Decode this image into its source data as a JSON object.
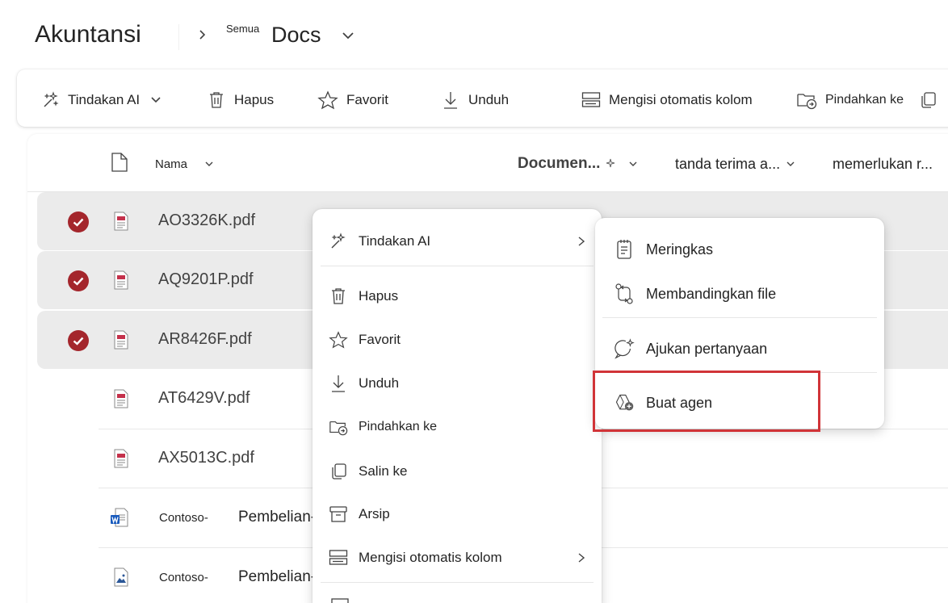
{
  "header": {
    "site_title": "Akuntansi",
    "breadcrumb_small": "Semua",
    "breadcrumb_main": "Docs"
  },
  "toolbar": {
    "ai_actions": "Tindakan AI",
    "delete": "Hapus",
    "favorite": "Favorit",
    "download": "Unduh",
    "autofill": "Mengisi otomatis kolom",
    "move_to": "Pindahkan ke"
  },
  "columns": {
    "name": "Nama",
    "document": "Documen...",
    "receipt": "tanda terima a...",
    "requires": "memerlukan r..."
  },
  "files": [
    {
      "name": "AO3326K.pdf",
      "selected": true,
      "type": "pdf"
    },
    {
      "name": "AQ9201P.pdf",
      "selected": true,
      "type": "pdf"
    },
    {
      "name": "AR8426F.pdf",
      "selected": true,
      "type": "pdf"
    },
    {
      "name": "AT6429V.pdf",
      "selected": false,
      "type": "pdf"
    },
    {
      "name": "AX5013C.pdf",
      "selected": false,
      "type": "pdf"
    },
    {
      "name_prefix": "Contoso-",
      "name_main": "Pembelian-",
      "selected": false,
      "type": "word"
    },
    {
      "name_prefix": "Contoso-",
      "name_main": "Pembelian-",
      "selected": false,
      "type": "image"
    }
  ],
  "context_menu": {
    "ai_actions": "Tindakan AI",
    "delete": "Hapus",
    "favorite": "Favorit",
    "download": "Unduh",
    "move_to": "Pindahkan ke",
    "copy_to": "Salin ke",
    "archive": "Arsip",
    "autofill": "Mengisi otomatis kolom"
  },
  "ai_submenu": {
    "summarize": "Meringkas",
    "compare": "Membandingkan file",
    "ask": "Ajukan pertanyaan",
    "create_agent": "Buat agen"
  },
  "colors": {
    "accent_red": "#a4262c",
    "highlight_box": "#d13438",
    "selected_row": "#ebebeb"
  }
}
